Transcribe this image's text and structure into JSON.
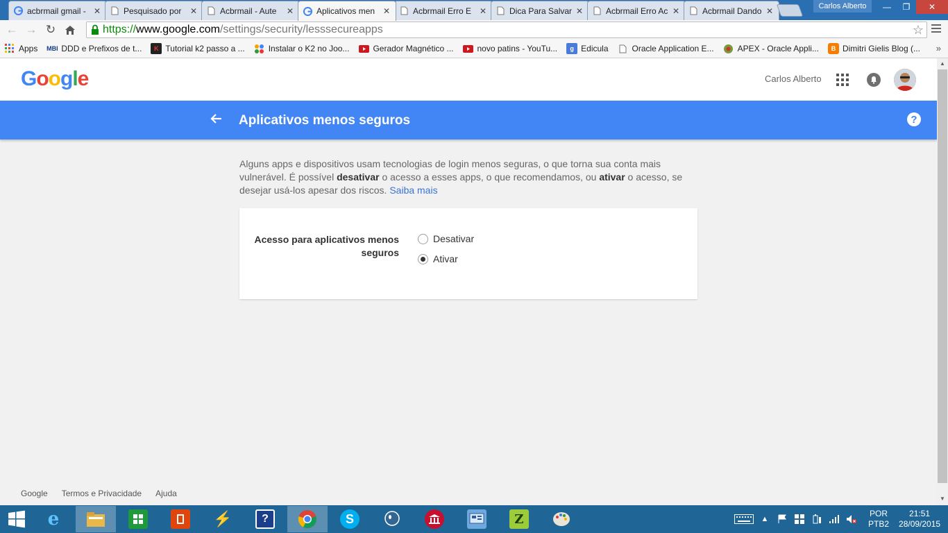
{
  "browser": {
    "tabs": [
      {
        "label": "acbrmail gmail -",
        "favicon": "google-icon"
      },
      {
        "label": "Pesquisado por",
        "favicon": "page-icon"
      },
      {
        "label": "Acbrmail - Aute",
        "favicon": "page-icon"
      },
      {
        "label": "Aplicativos men",
        "favicon": "google-icon",
        "active": true
      },
      {
        "label": "Acbrmail Erro E",
        "favicon": "page-icon"
      },
      {
        "label": "Dica Para Salvar",
        "favicon": "page-icon"
      },
      {
        "label": "Acbrmail Erro Ac",
        "favicon": "page-icon"
      },
      {
        "label": "Acbrmail Dando",
        "favicon": "page-icon"
      }
    ],
    "profile_name": "Carlos Alberto",
    "url": {
      "scheme": "https://",
      "host": "www.google.com",
      "path": "/settings/security/lesssecureapps"
    },
    "bookmarks": [
      {
        "label": "Apps",
        "icon": "apps-grid-icon"
      },
      {
        "label": "DDD e Prefixos de t...",
        "icon": "mbi-icon"
      },
      {
        "label": "Tutorial k2 passo a ...",
        "icon": "k2-icon"
      },
      {
        "label": "Instalar o K2 no Joo...",
        "icon": "joomla-icon"
      },
      {
        "label": "Gerador Magnético ...",
        "icon": "youtube-icon"
      },
      {
        "label": "novo patins - YouTu...",
        "icon": "youtube-icon"
      },
      {
        "label": "Edicula",
        "icon": "google-g-icon"
      },
      {
        "label": "Oracle Application E...",
        "icon": "page-icon"
      },
      {
        "label": "APEX - Oracle Appli...",
        "icon": "apex-icon"
      },
      {
        "label": "Dimitri Gielis Blog (...",
        "icon": "blogger-icon"
      }
    ],
    "bookmarks_more": "»"
  },
  "header": {
    "logo": "Google",
    "user_name": "Carlos Alberto"
  },
  "settings": {
    "title": "Aplicativos menos seguros",
    "help": "?",
    "description": {
      "part1": "Alguns apps e dispositivos usam tecnologias de login menos seguras, o que torna sua conta mais vulnerável. É possível ",
      "bold1": "desativar",
      "part2": " o acesso a esses apps, o que recomendamos, ou ",
      "bold2": "ativar",
      "part3": " o acesso, se desejar usá-los apesar dos riscos. ",
      "link": "Saiba mais"
    },
    "setting_label": "Acesso para aplicativos menos seguros",
    "options": [
      {
        "label": "Desativar",
        "selected": false
      },
      {
        "label": "Ativar",
        "selected": true
      }
    ]
  },
  "footer": {
    "links": [
      "Google",
      "Termos e Privacidade",
      "Ajuda"
    ]
  },
  "taskbar": {
    "apps": [
      "internet-explorer-icon",
      "file-explorer-icon",
      "store-icon",
      "office-icon",
      "power-icon",
      "help-icon",
      "chrome-icon",
      "skype-icon",
      "postgresql-icon",
      "bank-icon",
      "control-panel-icon",
      "zeos-icon",
      "paint-icon"
    ],
    "lang_top": "POR",
    "lang_bottom": "PTB2",
    "time": "21:51",
    "date": "28/09/2015"
  },
  "colors": {
    "blue_bar": "#4285f4",
    "link": "#3a73d6",
    "taskbar": "#1f6596",
    "tabstrip": "#2a6fb2"
  }
}
